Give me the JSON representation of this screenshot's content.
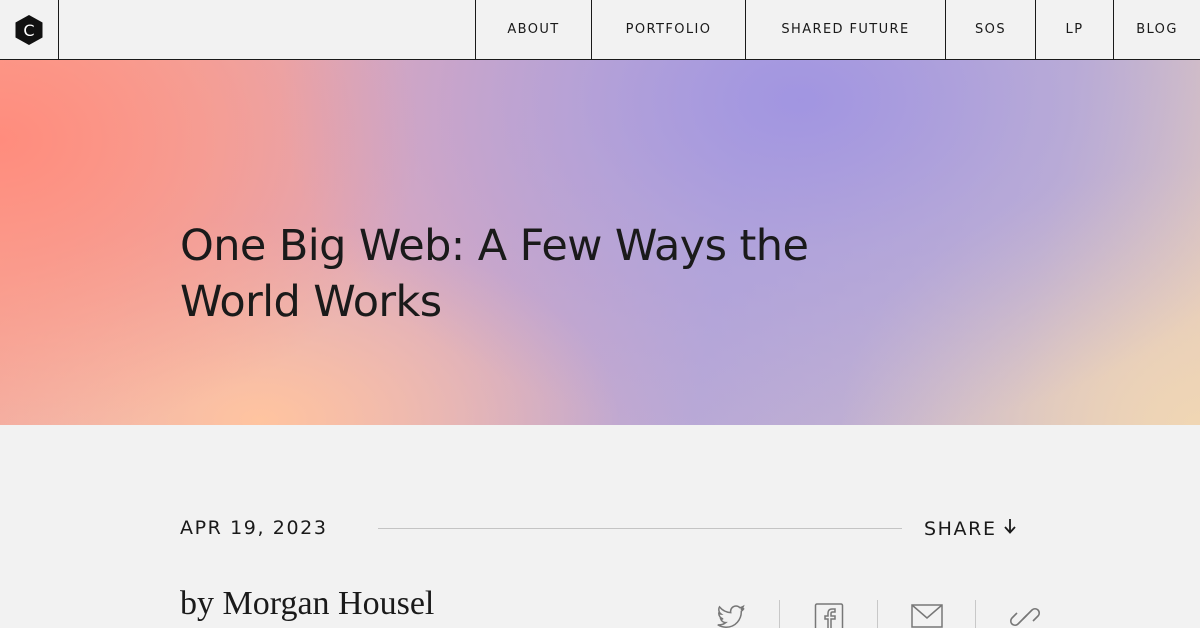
{
  "header": {
    "logo_letter": "C",
    "nav": [
      "ABOUT",
      "PORTFOLIO",
      "SHARED FUTURE",
      "SOS",
      "LP",
      "BLOG"
    ]
  },
  "hero": {
    "title": "One Big Web: A Few Ways the World Works"
  },
  "article": {
    "date": "APR 19, 2023",
    "share_label": "SHARE",
    "byline": "by Morgan Housel"
  },
  "share_icons": [
    "twitter-icon",
    "facebook-icon",
    "mail-icon",
    "link-icon"
  ],
  "colors": {
    "text": "#1a1a1a",
    "background": "#f2f2f2",
    "hero_coral": "#ff8c7d",
    "hero_lavender": "#a094e2",
    "hero_peach": "#ffc4a0"
  }
}
